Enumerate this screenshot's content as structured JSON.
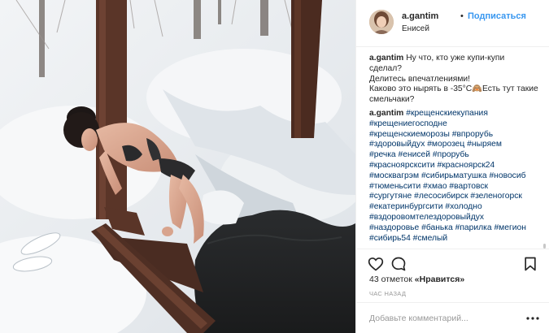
{
  "post": {
    "image_alt": "",
    "author": {
      "username": "a.gantim",
      "separator": "•",
      "follow_label": "Подписаться",
      "location": "Енисей",
      "avatar_icon": "avatar-photo"
    },
    "caption": {
      "username": "a.gantim",
      "lines": [
        "Ну что, кто уже купи-купи",
        "сделал?",
        "Делитесь впечатлениями!",
        "Каково это нырять в -35°С🙈Есть тут такие",
        "смельчаки?"
      ]
    },
    "hashtag_comment": {
      "username": "a.gantim",
      "lines": [
        "#крещенскиекупания",
        "#крещениегосподне",
        "#крещенскиеморозы #впрорубь",
        "#здоровыйдух #морозец #ныряем",
        "#речка #енисей #прорубь",
        "#красноярсксити #красноярск24",
        "#москвагрэм #сибирьматушка #новосиб",
        "#тюменьсити #хмао #вартовск",
        "#сургутяне #лесосибирск #зеленогорск",
        "#екатеринбургсити #холодно",
        "#вздоровомтелездоровыйдух",
        "#наздоровье #банька #парилка #мегион",
        "#сибирь54 #смелый"
      ]
    },
    "actions": {
      "like_icon": "heart-icon",
      "comment_icon": "comment-bubble-icon",
      "save_icon": "bookmark-icon"
    },
    "likes": {
      "count": "43 отметок",
      "link": "«Нравится»"
    },
    "time": "час назад",
    "comment_box": {
      "placeholder": "Добавьте комментарий...",
      "more_icon": "ellipsis-icon"
    }
  }
}
